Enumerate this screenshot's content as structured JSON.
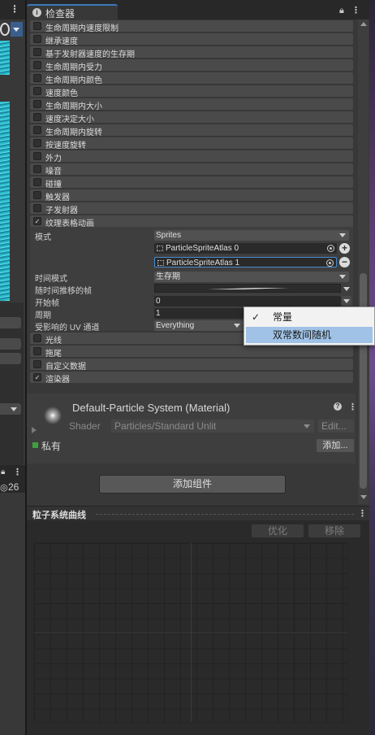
{
  "left_strip": {
    "count": "26"
  },
  "inspector": {
    "tab_title": "检查器",
    "modules_top": [
      {
        "label": "生命周期内速度限制",
        "checked": false
      },
      {
        "label": "继承速度",
        "checked": false
      },
      {
        "label": "基于发射器速度的生存期",
        "checked": false
      },
      {
        "label": "生命周期内受力",
        "checked": false
      },
      {
        "label": "生命周期内颜色",
        "checked": false
      },
      {
        "label": "速度颜色",
        "checked": false
      },
      {
        "label": "生命周期内大小",
        "checked": false
      },
      {
        "label": "速度决定大小",
        "checked": false
      },
      {
        "label": "生命周期内旋转",
        "checked": false
      },
      {
        "label": "按速度旋转",
        "checked": false
      },
      {
        "label": "外力",
        "checked": false
      },
      {
        "label": "噪音",
        "checked": false
      },
      {
        "label": "碰撞",
        "checked": false
      },
      {
        "label": "触发器",
        "checked": false
      },
      {
        "label": "子发射器",
        "checked": false
      },
      {
        "label": "纹理表格动画",
        "checked": true
      }
    ],
    "tsa": {
      "mode_label": "模式",
      "mode_value": "Sprites",
      "sprites": [
        "ParticleSpriteAtlas 0",
        "ParticleSpriteAtlas 1"
      ],
      "time_mode_label": "时间模式",
      "time_mode_value": "生存期",
      "frame_over_time_label": "随时间推移的帧",
      "start_frame_label": "开始帧",
      "start_frame_value": "0",
      "cycles_label": "周期",
      "cycles_value": "1",
      "uv_label": "受影响的 UV 通道",
      "uv_value": "Everything"
    },
    "modules_bottom": [
      {
        "label": "光线",
        "checked": false
      },
      {
        "label": "拖尾",
        "checked": false
      },
      {
        "label": "自定义数据",
        "checked": false
      },
      {
        "label": "渲染器",
        "checked": true
      }
    ],
    "material": {
      "title": "Default-Particle System (Material)",
      "shader_label": "Shader",
      "shader_value": "Particles/Standard Unlit",
      "edit_label": "Edit...",
      "private_label": "私有",
      "add_label": "添加..."
    },
    "add_component_label": "添加组件"
  },
  "curves": {
    "title": "粒子系统曲线",
    "optimize_label": "优化",
    "remove_label": "移除"
  },
  "popup": {
    "options": [
      "常量",
      "双常数间随机"
    ],
    "checked_index": 0,
    "highlighted_index": 1
  },
  "colors": {
    "accent": "#3a79bb",
    "popup_highlight": "#9fc2e6",
    "private_checkbox": "#3fa040"
  }
}
